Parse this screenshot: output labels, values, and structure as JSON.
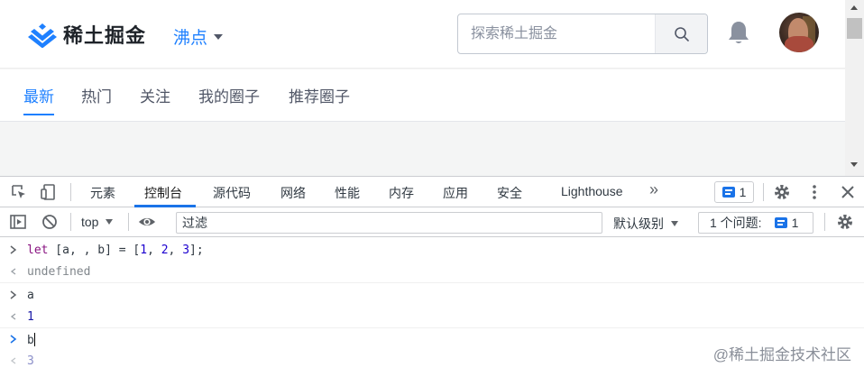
{
  "site": {
    "logo_text": "稀土掘金",
    "channel": "沸点",
    "search_placeholder": "探索稀土掘金",
    "tabs": [
      {
        "label": "最新",
        "active": true
      },
      {
        "label": "热门",
        "active": false
      },
      {
        "label": "关注",
        "active": false
      },
      {
        "label": "我的圈子",
        "active": false
      },
      {
        "label": "推荐圈子",
        "active": false
      }
    ]
  },
  "devtools": {
    "tabs": [
      "元素",
      "控制台",
      "源代码",
      "网络",
      "性能",
      "内存",
      "应用",
      "安全",
      "Lighthouse"
    ],
    "more_tabs": "»",
    "active_tab": "控制台",
    "issues_count": "1",
    "context": "top",
    "filter_placeholder": "过滤",
    "levels": "默认级别",
    "issues_label": "1 个问题:",
    "issues_label_count": "1"
  },
  "console": {
    "lines": [
      {
        "type": "input",
        "text": "let [a, , b] = [1, 2, 3];"
      },
      {
        "type": "output",
        "text": "undefined"
      },
      {
        "type": "input",
        "text": "a"
      },
      {
        "type": "output",
        "text": "1"
      },
      {
        "type": "input",
        "text": "b"
      },
      {
        "type": "output",
        "text": "3"
      }
    ]
  },
  "watermark": "@稀土掘金技术社区",
  "colors": {
    "brand": "#1e80ff",
    "devtools_accent": "#1a73e8"
  }
}
